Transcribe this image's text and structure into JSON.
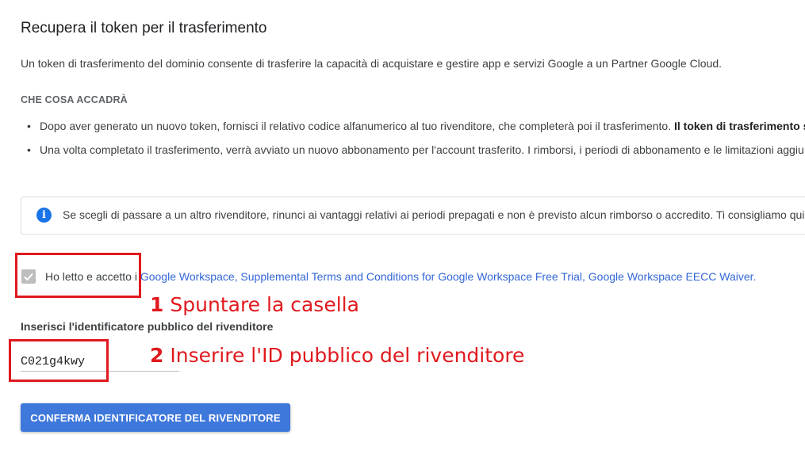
{
  "page": {
    "title": "Recupera il token per il trasferimento",
    "intro": "Un token di trasferimento del dominio consente di trasferire la capacità di acquistare e gestire app e servizi Google a un Partner Google Cloud.",
    "section_heading": "CHE COSA ACCADRÀ",
    "bullets": [
      {
        "text": "Dopo aver generato un nuovo token, fornisci il relativo codice alfanumerico al tuo rivenditore, che completerà poi il trasferimento. ",
        "bold": "Il token di trasferimento sc"
      },
      {
        "text": "Una volta completato il trasferimento, verrà avviato un nuovo abbonamento per l'account trasferito. I rimborsi, i periodi di abbonamento e le limitazioni aggiu"
      }
    ],
    "info_notice": "Se scegli di passare a un altro rivenditore, rinunci ai vantaggi relativi ai periodi prepagati e non è previsto alcun rimborso o accredito. Ti consigliamo quin",
    "terms": {
      "checked": true,
      "prefix": "Ho letto e accetto i ",
      "links": "Google Workspace, Supplemental Terms and Conditions for Google Workspace Free Trial, Google Workspace EECC Waiver."
    },
    "reseller_field": {
      "label": "Inserisci l'identificatore pubblico del rivenditore",
      "value": "C021g4kwy"
    },
    "confirm_button": "CONFERMA IDENTIFICATORE DEL RIVENDITORE"
  },
  "annotations": {
    "step1_number": "1",
    "step1_text": "Spuntare la casella",
    "step2_number": "2",
    "step2_text": "Inserire l'ID pubblico del rivenditore",
    "color": "#e0191e"
  },
  "colors": {
    "link": "#3367d6",
    "button": "#3f78db",
    "info_icon": "#1a73e8"
  },
  "icons": {
    "info": "info-icon",
    "checkbox": "checkmark-icon"
  }
}
